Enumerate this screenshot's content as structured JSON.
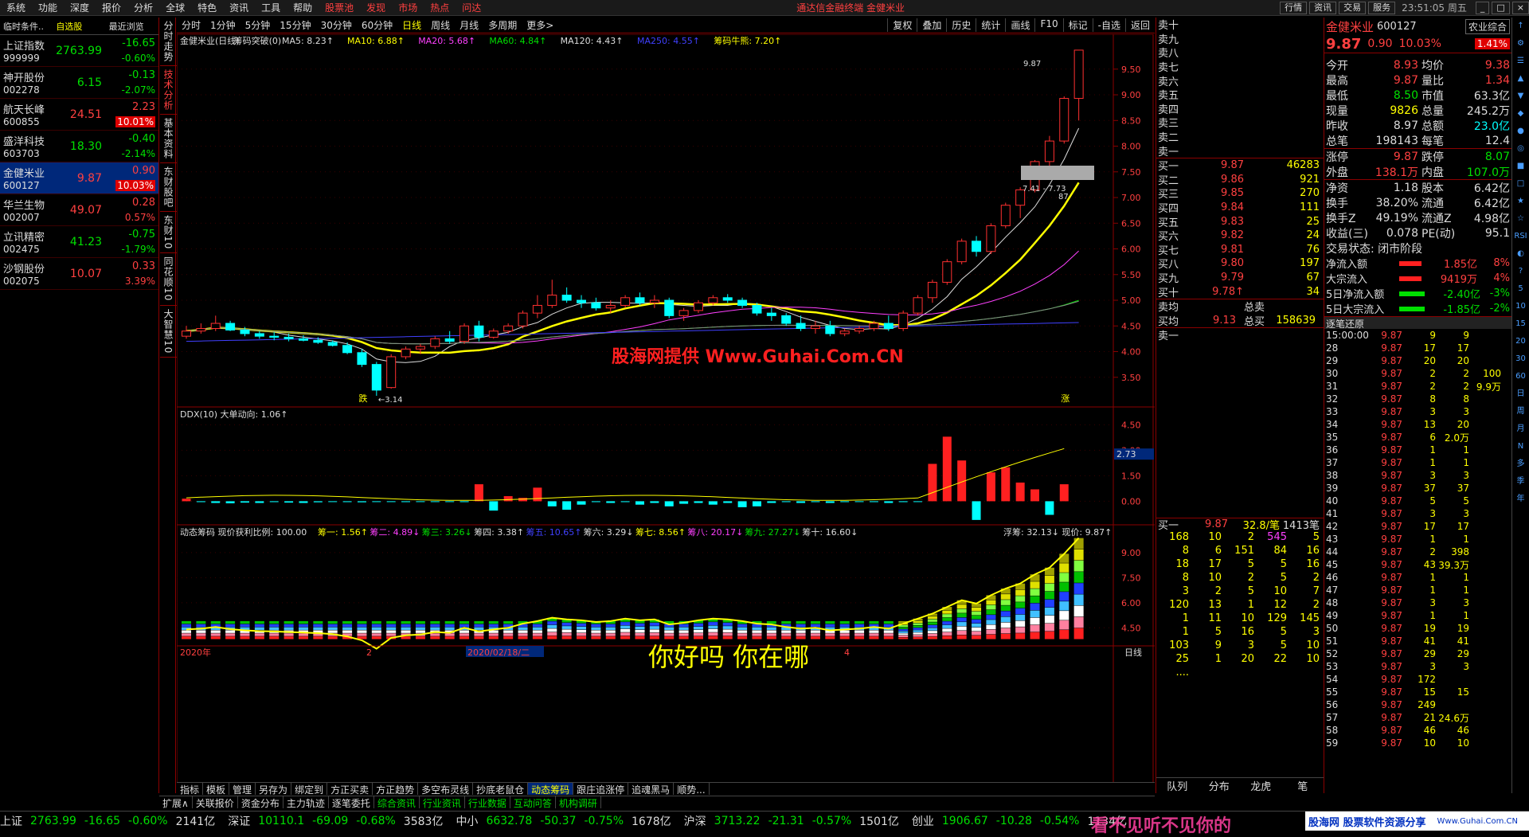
{
  "menu": [
    "系统",
    "功能",
    "深度",
    "报价",
    "分析",
    "全球",
    "特色",
    "资讯",
    "工具",
    "帮助",
    "股票池",
    "发现",
    "市场",
    "热点",
    "问达"
  ],
  "menu_title": "通达信金融终端  金健米业",
  "menu_right": [
    "行情",
    "资讯",
    "交易",
    "服务"
  ],
  "clock": "23:51:05 周五",
  "watch_header": [
    "临时条件..",
    "自选股",
    "最近浏览"
  ],
  "watch": [
    {
      "name": "上证指数",
      "code": "999999",
      "price": "2763.99",
      "chg": "-16.65",
      "pct": "-0.60%",
      "dir": "dn"
    },
    {
      "name": "神开股份",
      "code": "002278",
      "price": "6.15",
      "chg": "-0.13",
      "pct": "-2.07%",
      "dir": "dn"
    },
    {
      "name": "航天长峰",
      "code": "600855",
      "price": "24.51",
      "chg": "2.23",
      "pct": "10.01%",
      "dir": "up",
      "hl": true
    },
    {
      "name": "盛洋科技",
      "code": "603703",
      "price": "18.30",
      "chg": "-0.40",
      "pct": "-2.14%",
      "dir": "dn"
    },
    {
      "name": "金健米业",
      "code": "600127",
      "price": "9.87",
      "chg": "0.90",
      "pct": "10.03%",
      "dir": "up",
      "hl": true,
      "sel": true
    },
    {
      "name": "华兰生物",
      "code": "002007",
      "price": "49.07",
      "chg": "0.28",
      "pct": "0.57%",
      "dir": "up"
    },
    {
      "name": "立讯精密",
      "code": "002475",
      "price": "41.23",
      "chg": "-0.75",
      "pct": "-1.79%",
      "dir": "dn"
    },
    {
      "name": "沙钢股份",
      "code": "002075",
      "price": "10.07",
      "chg": "0.33",
      "pct": "3.39%",
      "dir": "up"
    }
  ],
  "vtabs": [
    "分时走势",
    "技术分析",
    "基本资料",
    "东财股吧",
    "东财10",
    "同花顺10",
    "大智慧10"
  ],
  "periods": [
    "分时",
    "1分钟",
    "5分钟",
    "15分钟",
    "30分钟",
    "60分钟",
    "日线",
    "周线",
    "月线",
    "多周期",
    "更多>"
  ],
  "period_right": [
    "复权",
    "叠加",
    "历史",
    "统计",
    "画线",
    "F10",
    "标记",
    "-自选",
    "返回"
  ],
  "main_legend": [
    {
      "t": "金健米业(日线)",
      "c": "#ddd"
    },
    {
      "t": "筹码突破(0)",
      "c": "#ddd"
    },
    {
      "t": "MA5: 8.23↑",
      "c": "#ddd"
    },
    {
      "t": "MA10: 6.88↑",
      "c": "#ffff00"
    },
    {
      "t": "MA20: 5.68↑",
      "c": "#ff40ff"
    },
    {
      "t": "MA60: 4.84↑",
      "c": "#00e000"
    },
    {
      "t": "MA120: 4.43↑",
      "c": "#ddd"
    },
    {
      "t": "MA250: 4.55↑",
      "c": "#4040ff"
    },
    {
      "t": "筹码牛熊: 7.20↑",
      "c": "#ffff00"
    }
  ],
  "watermark": "股海网提供 Www.Guhai.Com.CN",
  "price_axis": [
    "9.50",
    "9.00",
    "8.50",
    "8.00",
    "7.50",
    "7.00",
    "6.50",
    "6.00",
    "5.50",
    "5.00",
    "4.50",
    "4.00",
    "3.50"
  ],
  "annot_high": "9.87",
  "annot_low": "←3.14",
  "annot_range": "7.41 - 7.73",
  "annot_87": "87",
  "mark_die": "跌",
  "mark_zhang": "涨",
  "ddx_legend": "DDX(10)  大单动向: 1.06↑",
  "ddx_axis": [
    "4.50",
    "3.00",
    "1.50",
    "0.00"
  ],
  "ddx_cur": "2.73",
  "chip_legend": [
    {
      "t": "动态筹码  现价获利比例: 100.00",
      "c": "#ddd"
    },
    {
      "t": "筹一: 1.56↑",
      "c": "#ffff00"
    },
    {
      "t": "筹二: 4.89↓",
      "c": "#ff40ff"
    },
    {
      "t": "筹三: 3.26↓",
      "c": "#00e000"
    },
    {
      "t": "筹四: 3.38↑",
      "c": "#ddd"
    },
    {
      "t": "筹五: 10.65↑",
      "c": "#4040ff"
    },
    {
      "t": "筹六: 3.29↓",
      "c": "#ddd"
    },
    {
      "t": "筹七: 8.56↑",
      "c": "#ffff00"
    },
    {
      "t": "筹八: 20.17↓",
      "c": "#ff40ff"
    },
    {
      "t": "筹九: 27.27↓",
      "c": "#00e000"
    },
    {
      "t": "筹十: 16.60↓",
      "c": "#ddd"
    }
  ],
  "chip_right": "浮筹: 32.13↓  现价: 9.87↑",
  "chip_axis": [
    "9.00",
    "7.50",
    "6.00",
    "4.50"
  ],
  "date_labels": [
    "2020年",
    "2",
    "2020/02/18/二",
    "4"
  ],
  "date_axis": "日线",
  "overlay_text": "你好吗  你在哪",
  "tabs1": [
    "指标",
    "模板",
    "管理",
    "另存为",
    "绑定到",
    "方正买卖",
    "方正趋势",
    "多空布灵线",
    "抄底老鼠仓",
    "动态筹码",
    "跟庄追涨停",
    "追魂黑马",
    "顺势..."
  ],
  "tabs2": [
    "扩展∧",
    "关联报价",
    "资金分布",
    "主力轨迹",
    "逐笔委托",
    "综合资讯",
    "行业资讯",
    "行业数据",
    "互动问答",
    "机构调研"
  ],
  "ob_sell": [
    "卖十",
    "卖九",
    "卖八",
    "卖七",
    "卖六",
    "卖五",
    "卖四",
    "卖三",
    "卖二",
    "卖一"
  ],
  "ob_buy": [
    [
      "买一",
      "9.87",
      "46283"
    ],
    [
      "买二",
      "9.86",
      "921"
    ],
    [
      "买三",
      "9.85",
      "270"
    ],
    [
      "买四",
      "9.84",
      "111"
    ],
    [
      "买五",
      "9.83",
      "25"
    ],
    [
      "买六",
      "9.82",
      "24"
    ],
    [
      "买七",
      "9.81",
      "76"
    ],
    [
      "买八",
      "9.80",
      "197"
    ],
    [
      "买九",
      "9.79",
      "67"
    ],
    [
      "买十",
      "9.78↑",
      "34"
    ]
  ],
  "ob_avg": [
    [
      "卖均",
      "",
      "总卖",
      ""
    ],
    [
      "买均",
      "9.13",
      "总买",
      "158639"
    ]
  ],
  "ob_sell1": "卖一",
  "ob_buy1": [
    "买一",
    "9.87",
    "32.8/笔",
    "1413笔"
  ],
  "ob_grid": [
    [
      "168",
      "10",
      "2",
      "545",
      "5"
    ],
    [
      "8",
      "6",
      "151",
      "84",
      "16"
    ],
    [
      "18",
      "17",
      "5",
      "5",
      "16"
    ],
    [
      "8",
      "10",
      "2",
      "5",
      "2"
    ],
    [
      "3",
      "2",
      "5",
      "10",
      "7"
    ],
    [
      "120",
      "13",
      "1",
      "12",
      "2"
    ],
    [
      "1",
      "11",
      "10",
      "129",
      "145"
    ],
    [
      "1",
      "5",
      "16",
      "5",
      "3"
    ],
    [
      "103",
      "9",
      "3",
      "5",
      "10"
    ],
    [
      "25",
      "1",
      "20",
      "22",
      "10"
    ],
    [
      "....",
      "",
      "",
      "",
      ""
    ]
  ],
  "ob_right_tabs": [
    "队列",
    "分布",
    "龙虎",
    "笔"
  ],
  "quote": {
    "name": "金健米业",
    "code": "600127",
    "badge": "农业综合",
    "price": "9.87",
    "chg": "0.90",
    "pct": "10.03%",
    "amp": "1.41%"
  },
  "quote_rows": [
    [
      [
        "今开",
        "8.93",
        "up"
      ],
      [
        "均价",
        "9.38",
        "up"
      ]
    ],
    [
      [
        "最高",
        "9.87",
        "up"
      ],
      [
        "量比",
        "1.34",
        "up"
      ]
    ],
    [
      [
        "最低",
        "8.50",
        "dn"
      ],
      [
        "市值",
        "63.3亿",
        "wh"
      ]
    ],
    [
      [
        "现量",
        "9826",
        "yl"
      ],
      [
        "总量",
        "245.2万",
        "wh"
      ]
    ],
    [
      [
        "昨收",
        "8.97",
        "wh"
      ],
      [
        "总额",
        "23.0亿",
        "cy"
      ]
    ],
    [
      [
        "总笔",
        "198143",
        "wh"
      ],
      [
        "每笔",
        "12.4",
        "wh"
      ]
    ],
    [
      [
        "涨停",
        "9.87",
        "up"
      ],
      [
        "跌停",
        "8.07",
        "dn"
      ]
    ],
    [
      [
        "外盘",
        "138.1万",
        "up"
      ],
      [
        "内盘",
        "107.0万",
        "dn"
      ]
    ],
    [
      [
        "净资",
        "1.18",
        "wh"
      ],
      [
        "股本",
        "6.42亿",
        "wh"
      ]
    ],
    [
      [
        "换手",
        "38.20%",
        "wh"
      ],
      [
        "流通",
        "6.42亿",
        "wh"
      ]
    ],
    [
      [
        "换手Z",
        "49.19%",
        "wh"
      ],
      [
        "流通Z",
        "4.98亿",
        "wh"
      ]
    ],
    [
      [
        "收益(三)",
        "0.078",
        "wh"
      ],
      [
        "PE(动)",
        "95.1",
        "wh"
      ]
    ]
  ],
  "trade_status": "交易状态: 闭市阶段",
  "flows": [
    [
      "净流入额",
      "1.85亿",
      "8%",
      "up"
    ],
    [
      "大宗流入",
      "9419万",
      "4%",
      "up"
    ],
    [
      "5日净流入额",
      "-2.40亿",
      "-3%",
      "dn"
    ],
    [
      "5日大宗流入",
      "-1.85亿",
      "-2%",
      "dn"
    ]
  ],
  "tick_title": "逐笔还原",
  "ticks": [
    [
      "15:00:00",
      "9.87",
      "9",
      "9",
      ""
    ],
    [
      "28",
      "9.87",
      "17",
      "17",
      ""
    ],
    [
      "29",
      "9.87",
      "20",
      "20",
      ""
    ],
    [
      "30",
      "9.87",
      "2",
      "2",
      "100"
    ],
    [
      "31",
      "9.87",
      "2",
      "2",
      "9.9万"
    ],
    [
      "32",
      "9.87",
      "8",
      "8",
      ""
    ],
    [
      "33",
      "9.87",
      "3",
      "3",
      ""
    ],
    [
      "34",
      "9.87",
      "13",
      "20",
      ""
    ],
    [
      "35",
      "9.87",
      "6",
      "2.0万",
      ""
    ],
    [
      "36",
      "9.87",
      "1",
      "1",
      ""
    ],
    [
      "37",
      "9.87",
      "1",
      "1",
      ""
    ],
    [
      "38",
      "9.87",
      "3",
      "3",
      ""
    ],
    [
      "39",
      "9.87",
      "37",
      "37",
      ""
    ],
    [
      "40",
      "9.87",
      "5",
      "5",
      ""
    ],
    [
      "41",
      "9.87",
      "3",
      "3",
      ""
    ],
    [
      "42",
      "9.87",
      "17",
      "17",
      ""
    ],
    [
      "43",
      "9.87",
      "1",
      "1",
      ""
    ],
    [
      "44",
      "9.87",
      "2",
      "398",
      ""
    ],
    [
      "45",
      "9.87",
      "43",
      "39.3万",
      ""
    ],
    [
      "46",
      "9.87",
      "1",
      "1",
      ""
    ],
    [
      "47",
      "9.87",
      "1",
      "1",
      ""
    ],
    [
      "48",
      "9.87",
      "3",
      "3",
      ""
    ],
    [
      "49",
      "9.87",
      "1",
      "1",
      ""
    ],
    [
      "50",
      "9.87",
      "19",
      "19",
      ""
    ],
    [
      "51",
      "9.87",
      "41",
      "41",
      ""
    ],
    [
      "52",
      "9.87",
      "29",
      "29",
      ""
    ],
    [
      "53",
      "9.87",
      "3",
      "3",
      ""
    ],
    [
      "54",
      "9.87",
      "172",
      "",
      ""
    ],
    [
      "55",
      "9.87",
      "15",
      "15",
      ""
    ],
    [
      "56",
      "9.87",
      "249",
      "",
      ""
    ],
    [
      "57",
      "9.87",
      "21",
      "24.6万",
      ""
    ],
    [
      "58",
      "9.87",
      "46",
      "46",
      ""
    ],
    [
      "59",
      "9.87",
      "10",
      "10",
      ""
    ]
  ],
  "right_icons": [
    "↑",
    "⚙",
    "☰",
    "▲",
    "▼",
    "◆",
    "●",
    "◎",
    "■",
    "□",
    "★",
    "☆",
    "RSI",
    "◐",
    "?",
    "5",
    "10",
    "15",
    "20",
    "30",
    "60",
    "日",
    "周",
    "月",
    "N",
    "多",
    "季",
    "年"
  ],
  "status": [
    [
      "上证",
      "2763.99",
      "-16.65",
      "-0.60%",
      "2141亿"
    ],
    [
      "深证",
      "10110.1",
      "-69.09",
      "-0.68%",
      "3583亿"
    ],
    [
      "中小",
      "6632.78",
      "-50.37",
      "-0.75%",
      "1678亿"
    ],
    [
      "沪深",
      "3713.22",
      "-21.31",
      "-0.57%",
      "1501亿"
    ],
    [
      "创业",
      "1906.67",
      "-10.28",
      "-0.54%",
      "1134亿"
    ]
  ],
  "brand": "股海网 股票软件资源分享",
  "brand_url": "Www.Guhai.Com.CN",
  "status_overlay": "看不见听不见你的",
  "chart_data": {
    "type": "candlestick",
    "title": "金健米业(日线)",
    "ylim": [
      3.0,
      9.9
    ],
    "candles": [
      [
        4.3,
        4.5,
        4.25,
        4.4
      ],
      [
        4.4,
        4.55,
        4.35,
        4.45
      ],
      [
        4.45,
        4.7,
        4.4,
        4.55
      ],
      [
        4.55,
        4.6,
        4.4,
        4.42
      ],
      [
        4.42,
        4.48,
        4.3,
        4.35
      ],
      [
        4.35,
        4.4,
        4.25,
        4.3
      ],
      [
        4.3,
        4.38,
        4.22,
        4.28
      ],
      [
        4.28,
        4.35,
        4.2,
        4.25
      ],
      [
        4.25,
        4.32,
        4.2,
        4.22
      ],
      [
        4.22,
        4.28,
        4.15,
        4.18
      ],
      [
        4.18,
        4.22,
        4.1,
        4.12
      ],
      [
        4.12,
        4.18,
        3.95,
        3.98
      ],
      [
        3.98,
        4.05,
        3.7,
        3.75
      ],
      [
        3.75,
        3.8,
        3.14,
        3.25
      ],
      [
        3.3,
        3.95,
        3.28,
        3.9
      ],
      [
        3.9,
        4.1,
        3.85,
        4.05
      ],
      [
        4.05,
        4.15,
        3.95,
        4.1
      ],
      [
        4.1,
        4.3,
        4.05,
        4.25
      ],
      [
        4.25,
        4.4,
        4.15,
        4.2
      ],
      [
        4.2,
        4.55,
        4.15,
        4.5
      ],
      [
        4.5,
        4.6,
        4.2,
        4.28
      ],
      [
        4.28,
        4.45,
        4.25,
        4.4
      ],
      [
        4.4,
        4.55,
        4.35,
        4.5
      ],
      [
        4.5,
        4.8,
        4.45,
        4.75
      ],
      [
        4.75,
        5.1,
        4.65,
        4.9
      ],
      [
        4.9,
        5.4,
        4.85,
        5.1
      ],
      [
        5.1,
        5.25,
        4.95,
        5.0
      ],
      [
        5.0,
        5.1,
        4.85,
        4.95
      ],
      [
        4.95,
        5.05,
        4.8,
        4.85
      ],
      [
        4.85,
        5.0,
        4.75,
        4.9
      ],
      [
        4.9,
        5.1,
        4.85,
        5.05
      ],
      [
        5.05,
        5.15,
        4.9,
        4.95
      ],
      [
        4.95,
        5.1,
        4.85,
        5.0
      ],
      [
        5.0,
        5.05,
        4.65,
        4.7
      ],
      [
        4.7,
        4.85,
        4.6,
        4.8
      ],
      [
        4.8,
        5.0,
        4.75,
        4.95
      ],
      [
        4.95,
        5.1,
        4.9,
        5.05
      ],
      [
        5.05,
        5.12,
        4.95,
        5.0
      ],
      [
        5.0,
        5.05,
        4.85,
        4.9
      ],
      [
        4.9,
        4.95,
        4.7,
        4.75
      ],
      [
        4.75,
        4.85,
        4.6,
        4.7
      ],
      [
        4.7,
        4.75,
        4.5,
        4.55
      ],
      [
        4.55,
        4.7,
        4.4,
        4.45
      ],
      [
        4.45,
        4.6,
        4.35,
        4.5
      ],
      [
        4.5,
        4.6,
        4.3,
        4.35
      ],
      [
        4.35,
        4.45,
        4.3,
        4.4
      ],
      [
        4.4,
        4.5,
        4.35,
        4.45
      ],
      [
        4.45,
        4.6,
        4.4,
        4.55
      ],
      [
        4.55,
        4.7,
        4.4,
        4.45
      ],
      [
        4.45,
        4.8,
        4.4,
        4.75
      ],
      [
        4.75,
        5.1,
        4.7,
        5.05
      ],
      [
        5.05,
        5.4,
        4.95,
        5.35
      ],
      [
        5.35,
        5.8,
        5.3,
        5.75
      ],
      [
        5.75,
        6.2,
        5.7,
        6.15
      ],
      [
        6.15,
        6.25,
        5.85,
        5.95
      ],
      [
        5.95,
        6.5,
        5.9,
        6.45
      ],
      [
        6.45,
        6.9,
        6.4,
        6.85
      ],
      [
        6.85,
        7.2,
        6.6,
        7.15
      ],
      [
        7.15,
        7.73,
        7.1,
        7.7
      ],
      [
        7.7,
        8.2,
        7.41,
        8.1
      ],
      [
        8.1,
        8.97,
        8.05,
        8.93
      ],
      [
        8.93,
        9.87,
        8.5,
        9.87
      ]
    ],
    "ddx": [
      0.15,
      -0.05,
      -0.1,
      -0.12,
      -0.08,
      -0.1,
      -0.05,
      -0.08,
      -0.1,
      -0.06,
      -0.04,
      -0.05,
      -0.06,
      -0.04,
      -0.03,
      -0.05,
      -0.04,
      -0.03,
      -0.04,
      -0.05,
      1.0,
      -0.55,
      0.3,
      0.2,
      0.8,
      -0.3,
      -0.5,
      -0.2,
      -0.05,
      -0.1,
      -0.05,
      -0.2,
      -0.1,
      -0.3,
      -0.15,
      -0.1,
      -0.2,
      -0.1,
      -0.35,
      -0.3,
      -0.1,
      -0.05,
      -0.1,
      -0.05,
      -0.1,
      -0.05,
      -0.03,
      -0.05,
      -0.1,
      -0.05,
      -0.03,
      2.2,
      3.8,
      2.4,
      -1.1,
      1.7,
      2.0,
      1.1,
      0.7,
      -0.8,
      1.0
    ],
    "ddx_ylim": [
      -1.2,
      4.8
    ]
  }
}
